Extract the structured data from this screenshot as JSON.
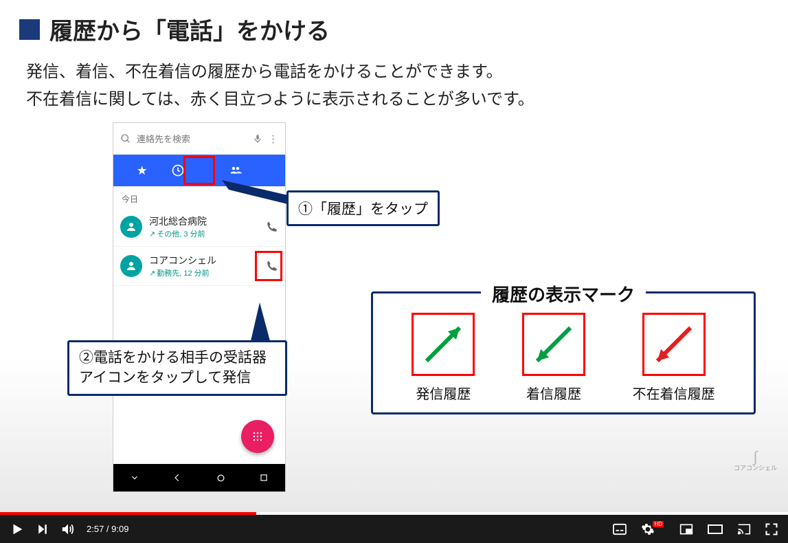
{
  "slide": {
    "title": "履歴から「電話」をかける",
    "description_line1": "発信、着信、不在着信の履歴から電話をかけることができます。",
    "description_line2": "不在着信に関しては、赤く目立つように表示されることが多いです。",
    "callout1": "①「履歴」をタップ",
    "callout2_line1": "②電話をかける相手の受話器",
    "callout2_line2": "アイコンをタップして発信",
    "legend_title": "履歴の表示マーク",
    "legend_items": [
      {
        "label": "発信履歴",
        "color": "#00a040",
        "dir": "out"
      },
      {
        "label": "着信履歴",
        "color": "#00a040",
        "dir": "in"
      },
      {
        "label": "不在着信履歴",
        "color": "#e02020",
        "dir": "in"
      }
    ]
  },
  "phone": {
    "search_placeholder": "連絡先を検索",
    "day_label": "今日",
    "entries": [
      {
        "name": "河北総合病院",
        "sub": "その他, 3 分前"
      },
      {
        "name": "コアコンシェル",
        "sub": "勤務先, 12 分前"
      }
    ]
  },
  "logo_text": "コアコンシェル",
  "player": {
    "current_time": "2:57",
    "duration": "9:09",
    "hd": "HD"
  }
}
